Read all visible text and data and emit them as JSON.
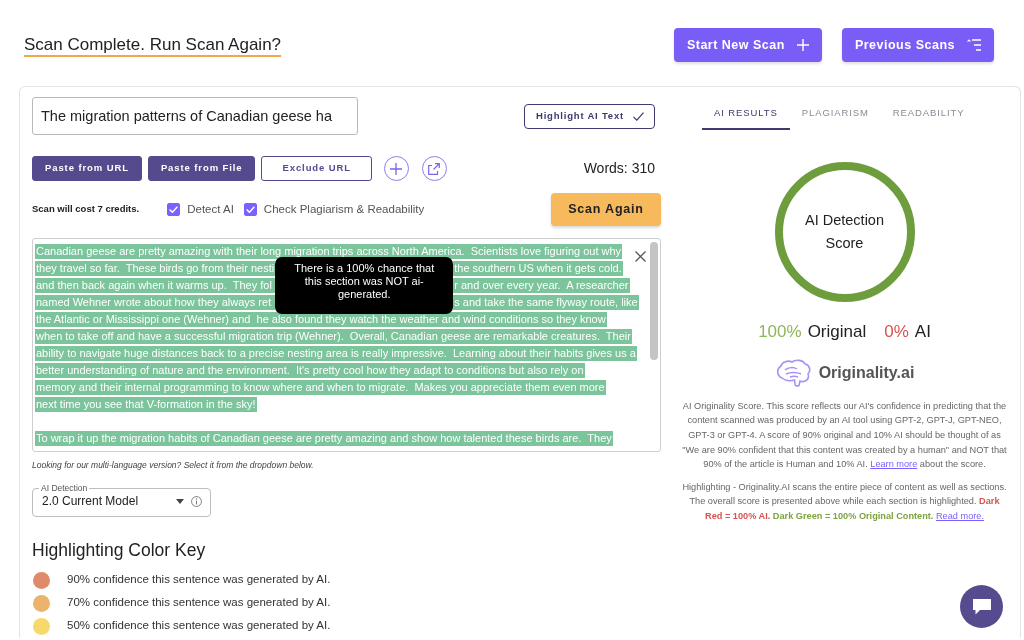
{
  "header": {
    "title": "Scan Complete. Run Scan Again?",
    "buttons": [
      {
        "label": "Start New Scan"
      },
      {
        "label": "Previous Scans"
      }
    ]
  },
  "editor": {
    "title_field": {
      "value": "The migration patterns of Canadian geese ha"
    },
    "highlight_button": {
      "label": "Highlight AI Text",
      "on": true
    },
    "source_buttons": [
      {
        "label": "Paste from URL",
        "kind": "filled"
      },
      {
        "label": "Paste from File",
        "kind": "filled"
      },
      {
        "label": "Exclude URL",
        "kind": "outline"
      }
    ],
    "word_count": "Words: 310",
    "cost_note": "Scan will cost 7 credits.",
    "options": [
      {
        "label": "Detect AI",
        "checked": true
      },
      {
        "label": "Check Plagiarism & Readability",
        "checked": true
      }
    ],
    "scan_button": "Scan Again",
    "text": {
      "paragraphs": [
        {
          "color": "#7cc49b",
          "lines": [
            {
              "kind": "whole",
              "text": "Canadian geese are pretty amazing with their long migration trips across North America.  Scientists love figuring out why"
            },
            {
              "kind": "covered",
              "visible_parts": [
                "they travel so far.  These birds go from their nesti",
                "the southern US when it gets cold."
              ]
            },
            {
              "kind": "covered",
              "visible_parts": [
                "and then back again when it warms up.  They fol",
                "r and over every year.  A researcher"
              ]
            },
            {
              "kind": "covered",
              "visible_parts": [
                "named Wehner wrote about how they always ret",
                "s and take the same flyway route, like"
              ]
            },
            {
              "kind": "whole",
              "text": "the Atlantic or Mississippi one (Wehner) and  he also found they watch the weather and wind conditions so they know"
            },
            {
              "kind": "whole",
              "text": "when to take off and have a successful migration trip (Wehner).  Overall, Canadian geese are remarkable creatures.  Their"
            },
            {
              "kind": "whole",
              "text": "ability to navigate huge distances back to a precise nesting area is really impressive.  Learning about their habits gives us a"
            },
            {
              "kind": "whole",
              "text": "better understanding of nature and the environment.  It's pretty cool how they adapt to conditions but also rely on"
            },
            {
              "kind": "whole",
              "text": "memory and their internal programming to know where and when to migrate.  Makes you appreciate them even more"
            },
            {
              "kind": "whole",
              "text": "next time you see that V-formation in the sky!"
            }
          ]
        },
        {
          "color": "#7cc49b",
          "lines": [
            {
              "kind": "whole",
              "text": "To wrap it up the migration habits of Canadian geese are pretty amazing and show how talented these birds are.  They"
            }
          ]
        }
      ]
    },
    "tooltip": "There is a 100% chance that this section was NOT ai-generated.",
    "multilang_note": "Looking for our multi-language version? Select it from the dropdown below.",
    "model_select": {
      "label": "AI Detection",
      "value": "2.0 Current Model"
    }
  },
  "color_key": {
    "title": "Highlighting Color Key",
    "items": [
      {
        "color": "#e08a6c",
        "text": "90% confidence this sentence was generated by AI."
      },
      {
        "color": "#ebb36c",
        "text": "70% confidence this sentence was generated by AI."
      },
      {
        "color": "#f6d86c",
        "text": "50% confidence this sentence was generated by AI."
      }
    ]
  },
  "results": {
    "tabs": [
      {
        "label": "AI RESULTS",
        "selected": true
      },
      {
        "label": "PLAGIARISM",
        "selected": false
      },
      {
        "label": "READABILITY",
        "selected": false
      }
    ],
    "score": {
      "title": "AI Detection Score",
      "level": 1,
      "original_value": "100%",
      "original_label": "Original",
      "ai_value": "0%",
      "ai_label": "AI"
    },
    "logo": "Originality.ai",
    "notes": [
      {
        "parts": [
          {
            "kind": "plain",
            "text": "AI Originality Score. This score reflects our AI's confidence in predicting that the content scanned was produced by an AI tool using GPT-2, GPT-J, GPT-NEO, GPT-3 or GPT-4. A score of 90% original and 10% AI should be thought of as \"We are 90% confident that this content was created by a human\" and NOT that 90% of the article is Human and 10% AI."
          },
          {
            "kind": "link",
            "text": "Learn more"
          },
          {
            "kind": "plain",
            "text": "about the score."
          }
        ]
      },
      {
        "parts": [
          {
            "kind": "plain",
            "text": "Highlighting - Originality.AI scans the entire piece of content as well as sections. The overall score is presented above while each section is highlighted."
          },
          {
            "kind": "ai",
            "text": "Dark Red = 100% AI."
          },
          {
            "kind": "original",
            "text": "Dark Green = 100% Original Content."
          },
          {
            "kind": "link",
            "text": "Read more."
          }
        ]
      }
    ]
  }
}
